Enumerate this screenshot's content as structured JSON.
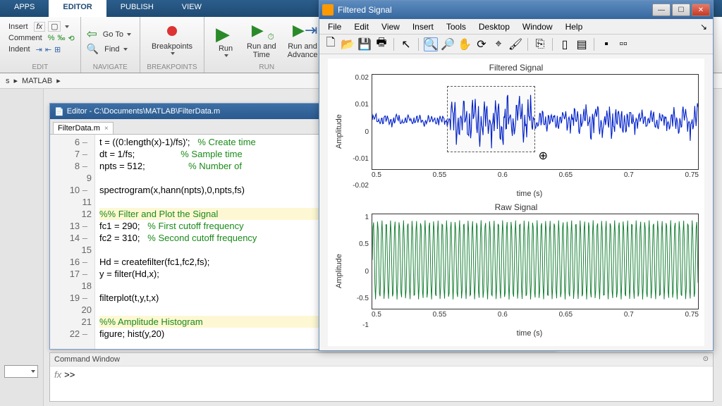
{
  "ribbon": {
    "tabs": [
      "APPS",
      "EDITOR",
      "PUBLISH",
      "VIEW"
    ],
    "active": 1
  },
  "toolstrip": {
    "edit": {
      "insert": "Insert",
      "comment": "Comment",
      "indent": "Indent",
      "title": "EDIT"
    },
    "navigate": {
      "goto": "Go To",
      "find": "Find",
      "title": "NAVIGATE"
    },
    "breakpoints": {
      "label": "Breakpoints",
      "title": "BREAKPOINTS"
    },
    "run": {
      "run": "Run",
      "runtime": "Run and\nTime",
      "runadv": "Run and\nAdvance",
      "title": "RUN"
    }
  },
  "breadcrumb": {
    "seg1": "s",
    "seg2": "MATLAB"
  },
  "editor": {
    "title": "Editor - C:\\Documents\\MATLAB\\FilterData.m",
    "tab": "FilterData.m",
    "lines": [
      {
        "n": "6",
        "dash": true,
        "html": "t = ((0:length(x)-1)/fs)';   <span class='cmt'>% Create time</span>"
      },
      {
        "n": "7",
        "dash": true,
        "html": "dt = 1/fs;                  <span class='cmt'>% Sample time</span>"
      },
      {
        "n": "8",
        "dash": true,
        "html": "npts = 512;                 <span class='cmt'>% Number of</span>"
      },
      {
        "n": "9",
        "dash": false,
        "html": ""
      },
      {
        "n": "10",
        "dash": true,
        "html": "spectrogram(x,hann(npts),0,npts,fs)"
      },
      {
        "n": "11",
        "dash": false,
        "html": ""
      },
      {
        "n": "12",
        "dash": false,
        "html": "<span class='section'><span class='cmt'>%% Filter and Plot the Signal</span></span>"
      },
      {
        "n": "13",
        "dash": true,
        "html": "fc1 = 290;   <span class='cmt'>% First cutoff frequency</span>"
      },
      {
        "n": "14",
        "dash": true,
        "html": "fc2 = 310;   <span class='cmt'>% Second cutoff frequency</span>"
      },
      {
        "n": "15",
        "dash": false,
        "html": ""
      },
      {
        "n": "16",
        "dash": true,
        "html": "Hd = createfilter(fc1,fc2,fs);"
      },
      {
        "n": "17",
        "dash": true,
        "html": "y = filter(Hd,x);"
      },
      {
        "n": "18",
        "dash": false,
        "html": ""
      },
      {
        "n": "19",
        "dash": true,
        "html": "filterplot(t,y,t,x)"
      },
      {
        "n": "20",
        "dash": false,
        "html": ""
      },
      {
        "n": "21",
        "dash": false,
        "html": "<span class='section'><span class='cmt'>%% Amplitude Histogram</span></span>"
      },
      {
        "n": "22",
        "dash": true,
        "html": "figure; hist(y,20)"
      }
    ]
  },
  "cmdwin": {
    "title": "Command Window",
    "prompt": ">>"
  },
  "figure": {
    "title": "Filtered Signal",
    "menus": [
      "File",
      "Edit",
      "View",
      "Insert",
      "Tools",
      "Desktop",
      "Window",
      "Help"
    ],
    "plot1": {
      "title": "Filtered Signal",
      "ylabel": "Amplitude",
      "xlabel": "time (s)",
      "xticks": [
        "0.5",
        "0.55",
        "0.6",
        "0.65",
        "0.7",
        "0.75"
      ],
      "yticks": [
        "0.02",
        "0.01",
        "0",
        "-0.01",
        "-0.02"
      ]
    },
    "plot2": {
      "title": "Raw Signal",
      "ylabel": "Amplitude",
      "xlabel": "time (s)",
      "xticks": [
        "0.5",
        "0.55",
        "0.6",
        "0.65",
        "0.7",
        "0.75"
      ],
      "yticks": [
        "1",
        "0.5",
        "0",
        "-0.5",
        "-1"
      ]
    }
  },
  "chart_data": [
    {
      "type": "line",
      "title": "Filtered Signal",
      "xlabel": "time (s)",
      "ylabel": "Amplitude",
      "xlim": [
        0.5,
        0.75
      ],
      "ylim": [
        -0.02,
        0.02
      ],
      "note": "Noisy oscillatory signal, amplitude roughly ±0.005 for t<0.56 then bursts to ±0.012 between 0.56-0.63, tapering to ±0.008 by 0.75",
      "zoom_region": {
        "x0": 0.558,
        "x1": 0.626,
        "y0": -0.014,
        "y1": 0.012
      }
    },
    {
      "type": "line",
      "title": "Raw Signal",
      "xlabel": "time (s)",
      "ylabel": "Amplitude",
      "xlim": [
        0.5,
        0.75
      ],
      "ylim": [
        -1,
        1
      ],
      "note": "Dense high-frequency sinusoid near full amplitude ±1 throughout the window",
      "approx_frequency_hz": 300
    }
  ]
}
